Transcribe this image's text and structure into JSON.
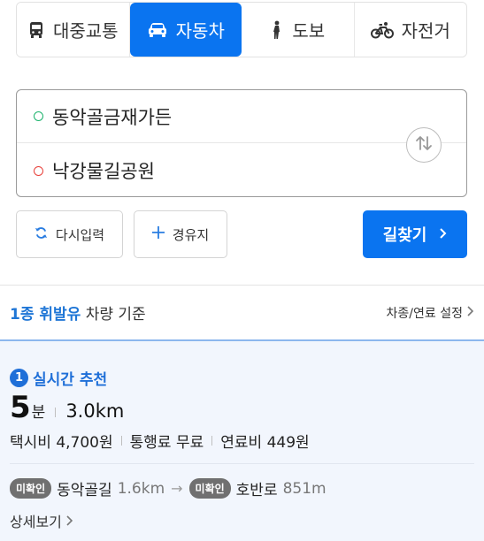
{
  "mode_tabs": [
    {
      "label": "대중교통",
      "icon": "bus-icon"
    },
    {
      "label": "자동차",
      "icon": "car-icon"
    },
    {
      "label": "도보",
      "icon": "walk-icon"
    },
    {
      "label": "자전거",
      "icon": "bicycle-icon"
    }
  ],
  "active_tab": "자동차",
  "route": {
    "origin": "동악골금재가든",
    "destination": "낙강물길공원",
    "swap_icon": "swap-icon"
  },
  "buttons": {
    "reset_label": "다시입력",
    "via_label": "경유지",
    "search_label": "길찾기"
  },
  "vehicle": {
    "type_highlight": "1종 휘발유",
    "basis_suffix": " 차량 기준",
    "settings_label": "차종/연료 설정"
  },
  "result": {
    "rank": "1",
    "recommend_label": "실시간 추천",
    "time_value": "5",
    "time_unit": "분",
    "distance": "3.0km",
    "taxi_fare": "택시비 4,700원",
    "toll": "통행료 무료",
    "fuel": "연료비 449원",
    "roads": [
      {
        "badge": "미확인",
        "name": "동악골길",
        "distance": "1.6km"
      },
      {
        "badge": "미확인",
        "name": "호반로",
        "distance": "851m"
      }
    ],
    "detail_label": "상세보기"
  },
  "colors": {
    "primary": "#0a74f0",
    "highlight_text": "#1f76d6",
    "card_bg": "#f2f6fd",
    "origin_dot": "#1ab26b",
    "destination_dot": "#e8403a"
  }
}
